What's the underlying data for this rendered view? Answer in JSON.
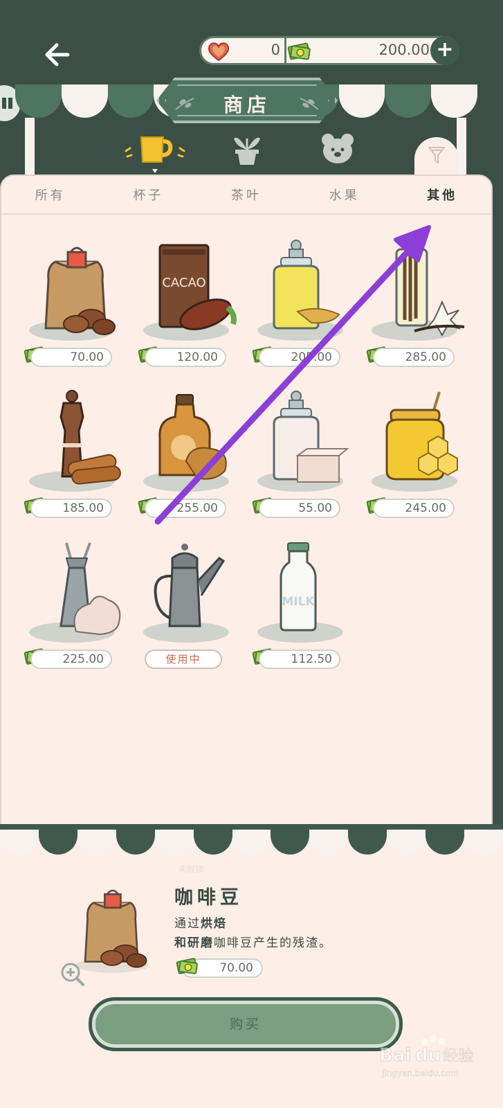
{
  "header": {
    "hearts": "0",
    "money": "200.00",
    "plus_label": "+"
  },
  "shop": {
    "title": "商店"
  },
  "tabs": [
    {
      "label": "所有"
    },
    {
      "label": "杯子"
    },
    {
      "label": "茶叶"
    },
    {
      "label": "水果"
    },
    {
      "label": "其他",
      "active": true
    }
  ],
  "items": [
    {
      "icon": "coffee-beans-bag",
      "price": "70.00"
    },
    {
      "icon": "cacao-tin",
      "price": "120.00",
      "art_text": "CACAO"
    },
    {
      "icon": "ginger-jar",
      "price": "205.00"
    },
    {
      "icon": "vanilla-jar",
      "price": "285.00"
    },
    {
      "icon": "cinnamon-grinder",
      "price": "185.00"
    },
    {
      "icon": "caramel-bottle",
      "price": "255.00"
    },
    {
      "icon": "sugar-jar",
      "price": "55.00"
    },
    {
      "icon": "honey-jar",
      "price": "245.00"
    },
    {
      "icon": "cream-dispenser",
      "price": "225.00"
    },
    {
      "icon": "kettle",
      "status": "使用中"
    },
    {
      "icon": "milk-bottle",
      "price": "112.50",
      "art_text": "MILK"
    }
  ],
  "detail": {
    "faded_label": "未解锁",
    "name": "咖啡豆",
    "desc_line1_a": "通过",
    "desc_line1_b": "烘焙",
    "desc_line2_a": "和研磨",
    "desc_line2_b": "咖啡豆产生的残渣。",
    "price": "70.00",
    "buy_label": "购买"
  },
  "watermark": {
    "brand": "Bai",
    "brand_b": "du",
    "cn": "经验",
    "url": "jingyan.baidu.com"
  },
  "colors": {
    "dark_green": "#3b4f46",
    "awning_green": "#4e7462",
    "panel_bg": "#fdeee7",
    "accent_yellow": "#f2c230",
    "annotation_arrow": "#8b3fd6"
  }
}
